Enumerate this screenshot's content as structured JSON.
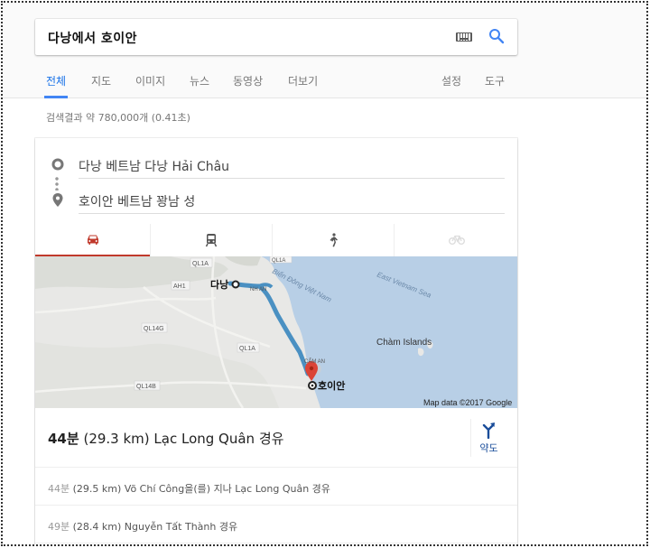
{
  "search": {
    "query": "다낭에서 호이안"
  },
  "tabs": [
    {
      "label": "전체",
      "active": true
    },
    {
      "label": "지도"
    },
    {
      "label": "이미지"
    },
    {
      "label": "뉴스"
    },
    {
      "label": "동영상"
    },
    {
      "label": "더보기"
    },
    {
      "label": "설정"
    },
    {
      "label": "도구"
    }
  ],
  "results": {
    "count_text": "검색결과 약 780,000개 (0.41초)"
  },
  "directions": {
    "origin": "다낭 베트남 다낭 Hải Châu",
    "destination": "호이안 베트남 꽝남 성",
    "active_mode": "driving"
  },
  "map": {
    "labels": {
      "ql1a_top": "QL1A",
      "ah1": "AH1",
      "ql14g": "QL14G",
      "ql1a_mid": "QL1A",
      "ql14b": "QL14B",
      "ql1a_low": "QL1A",
      "nhan": "NH AN",
      "bien_dong": "Biển Đông Việt Nam",
      "east_vietnam_sea": "East Vietnam Sea",
      "cham_islands": "Chàm Islands",
      "cam_an": "CẨM AN",
      "origin_city": "다낭",
      "dest_city": "호이안",
      "attribution": "Map data ©2017 Google"
    },
    "colors": {
      "water": "#b8cfe6",
      "land": "#e8e8e6",
      "route": "#4a90c2",
      "pin": "#db4437"
    }
  },
  "route": {
    "duration": "44분",
    "detail": "(29.3 km) Lạc Long Quân 경유",
    "route_button_label": "약도"
  },
  "alternatives": [
    {
      "duration": "44분",
      "detail": "(29.5 km) Võ Chí Công을(를) 지나 Lạc Long Quân 경유"
    },
    {
      "duration": "49분",
      "detail": "(28.4 km) Nguyễn Tất Thành 경유"
    }
  ]
}
